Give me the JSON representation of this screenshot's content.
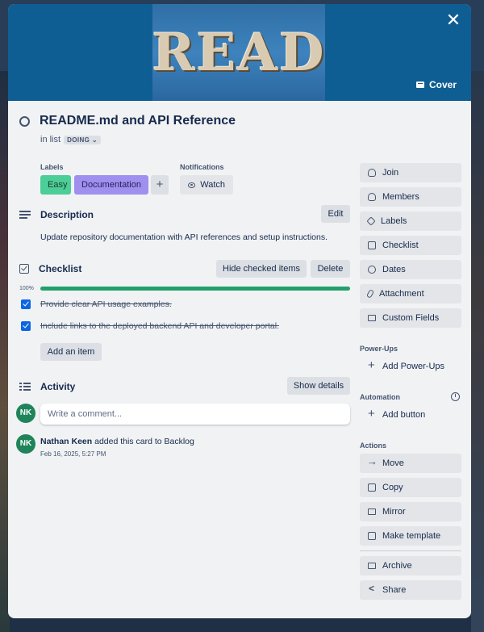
{
  "cover": {
    "art_text": "READ",
    "cover_button": "Cover",
    "close_glyph": "✕"
  },
  "card": {
    "title": "README.md and API Reference",
    "in_list_prefix": "in list",
    "list_name": "DOING",
    "list_chevron": "⌄"
  },
  "labels": {
    "heading": "Labels",
    "items": [
      "Easy",
      "Documentation"
    ],
    "add_glyph": "+"
  },
  "notifications": {
    "heading": "Notifications",
    "watch_label": "Watch"
  },
  "description": {
    "heading": "Description",
    "edit_label": "Edit",
    "text": "Update repository documentation with API references and setup instructions."
  },
  "checklist": {
    "heading": "Checklist",
    "hide_label": "Hide checked items",
    "delete_label": "Delete",
    "percent_text": "100%",
    "progress": 1.0,
    "items": [
      "Provide clear API usage examples.",
      "Include links to the deployed backend API and developer portal."
    ],
    "add_item_label": "Add an item"
  },
  "activity": {
    "heading": "Activity",
    "show_details_label": "Show details",
    "comment_placeholder": "Write a comment...",
    "avatar_initials": "NK",
    "entry_user": "Nathan Keen",
    "entry_text": " added this card to Backlog",
    "entry_time": "Feb 16, 2025, 5:27 PM"
  },
  "sidebar": {
    "card_actions": [
      "Join",
      "Members",
      "Labels",
      "Checklist",
      "Dates",
      "Attachment",
      "Custom Fields"
    ],
    "powerups_heading": "Power-Ups",
    "add_powerups": "Add Power-Ups",
    "automation_heading": "Automation",
    "add_button": "Add button",
    "actions_heading": "Actions",
    "actions": [
      "Move",
      "Copy",
      "Mirror",
      "Make template"
    ],
    "archive": "Archive",
    "share": "Share"
  },
  "colors": {
    "label_easy": "#4bce97",
    "label_documentation": "#9f8fef",
    "progress_fill": "#22a06b",
    "checkbox": "#0c66e4",
    "avatar": "#1f845a",
    "cover": "#0f5e93"
  }
}
